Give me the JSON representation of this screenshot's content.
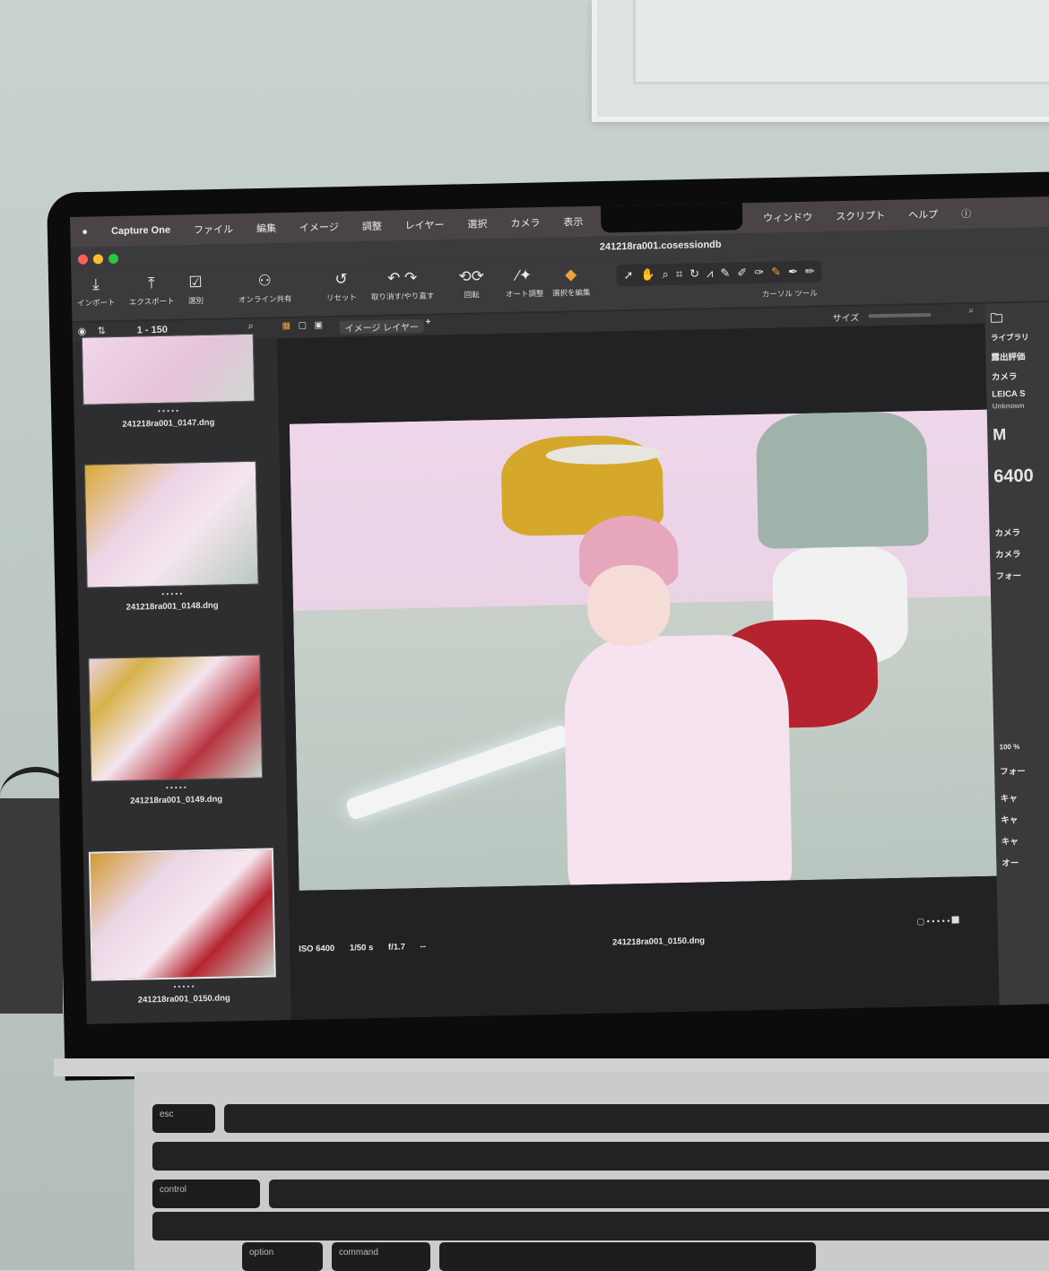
{
  "menubar": {
    "app": "Capture One",
    "items": [
      "ファイル",
      "編集",
      "イメージ",
      "調整",
      "レイヤー",
      "選択",
      "カメラ",
      "表示"
    ],
    "right_items": [
      "ウィンドウ",
      "スクリプト",
      "ヘルプ"
    ]
  },
  "window": {
    "title": "241218ra001.cosessiondb"
  },
  "toolbar": {
    "import": "インポート",
    "export": "エクスポート",
    "process": "選別",
    "share": "オンライン共有",
    "reset": "リセット",
    "undo_redo": "取り消す/やり直す",
    "rotate": "回転",
    "auto_adjust": "オート調整",
    "edit_selection": "選択を編集",
    "cursor_tools": "カーソル ツール",
    "size_label": "サイズ"
  },
  "browser": {
    "range": "1 - 150",
    "thumbnails": [
      {
        "file": "241218ra001_0147.dng",
        "rating": "• • • • •"
      },
      {
        "file": "241218ra001_0148.dng",
        "rating": "• • • • •"
      },
      {
        "file": "241218ra001_0149.dng",
        "rating": "• • • • •"
      },
      {
        "file": "241218ra001_0150.dng",
        "rating": "• • • • •"
      }
    ]
  },
  "viewer": {
    "mode": "イメージ レイヤー",
    "iso": "ISO 6400",
    "shutter": "1/50 s",
    "aperture": "f/1.7",
    "dash": "--",
    "filename": "241218ra001_0150.dng",
    "rating": "• • • • •"
  },
  "sidebar": {
    "library": "ライブラリ",
    "exposure_rating": "露出評価",
    "camera": "カメラ",
    "lens": "LEICA S",
    "unknown": "Unknown",
    "mode": "M",
    "iso_value": "6400",
    "camera2": "カメラ",
    "camera3": "カメラ",
    "focus": "フォー",
    "zoom": "100 %",
    "focus2": "フォー",
    "cap1": "キャ",
    "cap2": "キャ",
    "cap3": "キャ",
    "other": "オー"
  },
  "keyboard": {
    "control": "control",
    "option": "option",
    "command": "command",
    "esc": "esc"
  }
}
